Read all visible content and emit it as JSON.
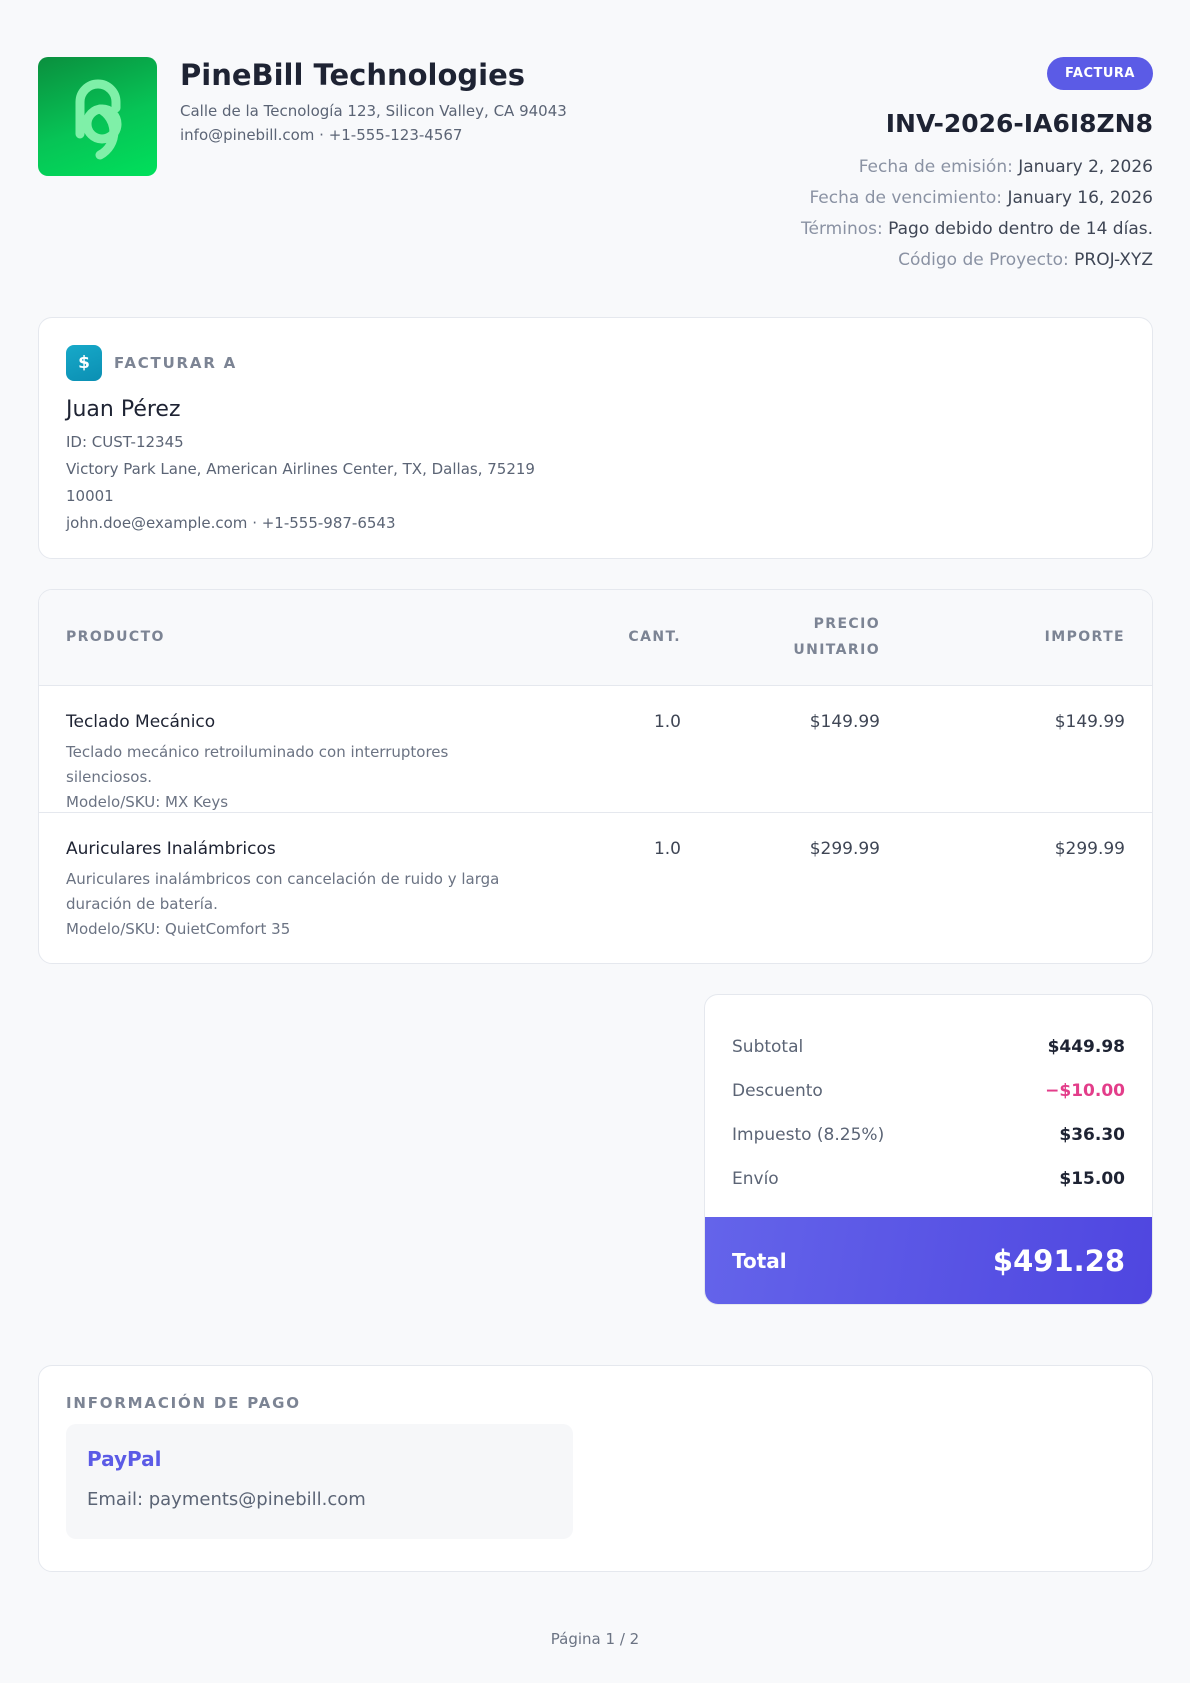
{
  "company": {
    "name": "PineBill Technologies",
    "address": "Calle de la Tecnología 123, Silicon Valley, CA 94043",
    "contact": "info@pinebill.com · +1-555-123-4567",
    "logo_icon": "pinebill-logo-icon"
  },
  "invoice": {
    "badge": "FACTURA",
    "number": "INV-2026-IA6I8ZN8",
    "issue_label": "Fecha de emisión:",
    "issue_value": "January 2, 2026",
    "due_label": "Fecha de vencimiento:",
    "due_value": "January 16, 2026",
    "terms_label": "Términos:",
    "terms_value": "Pago debido dentro de 14 días.",
    "project_label": "Código de Proyecto:",
    "project_value": "PROJ-XYZ"
  },
  "bill_to": {
    "title": "FACTURAR A",
    "icon": "$",
    "name": "Juan Pérez",
    "id": "ID: CUST-12345",
    "address": "Victory Park Lane, American Airlines Center, TX, Dallas, 75219",
    "postal": "10001",
    "contact": "john.doe@example.com · +1-555-987-6543"
  },
  "table": {
    "headers": {
      "product": "PRODUCTO",
      "qty": "CANT.",
      "unit_line1": "PRECIO",
      "unit_line2": "UNITARIO",
      "amount": "IMPORTE"
    },
    "rows": [
      {
        "name": "Teclado Mecánico",
        "description": "Teclado mecánico retroiluminado con interruptores silenciosos.",
        "sku": "Modelo/SKU: MX Keys",
        "qty": "1.0",
        "unit_price": "$149.99",
        "amount": "$149.99"
      },
      {
        "name": "Auriculares Inalámbricos",
        "description": "Auriculares inalámbricos con cancelación de ruido y larga duración de batería.",
        "sku": "Modelo/SKU: QuietComfort 35",
        "qty": "1.0",
        "unit_price": "$299.99",
        "amount": "$299.99"
      }
    ]
  },
  "totals": {
    "subtotal_label": "Subtotal",
    "subtotal_value": "$449.98",
    "discount_label": "Descuento",
    "discount_value": "−$10.00",
    "tax_label": "Impuesto (8.25%)",
    "tax_value": "$36.30",
    "shipping_label": "Envío",
    "shipping_value": "$15.00",
    "total_label": "Total",
    "total_value": "$491.28"
  },
  "payment": {
    "title": "INFORMACIÓN DE PAGO",
    "method": "PayPal",
    "detail": "Email: payments@pinebill.com"
  },
  "footer": {
    "page": "Página 1 / 2"
  },
  "colors": {
    "accent": "#5b5be6",
    "brand_green": "#07c456",
    "discount": "#e33d8a"
  }
}
